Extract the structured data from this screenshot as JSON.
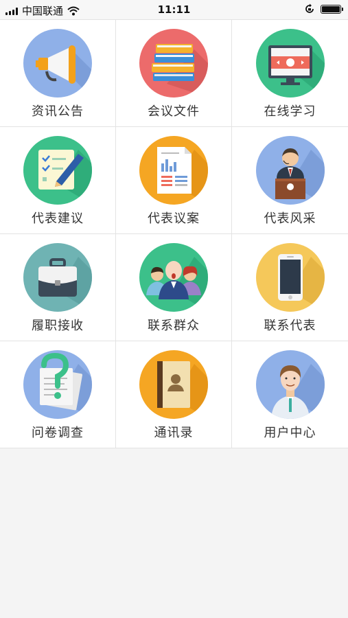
{
  "status_bar": {
    "carrier": "中国联通",
    "time": "11:11"
  },
  "menu": [
    {
      "label": "资讯公告",
      "icon": "megaphone-icon",
      "color": "#8fb0e8"
    },
    {
      "label": "会议文件",
      "icon": "books-icon",
      "color": "#ec6b6b"
    },
    {
      "label": "在线学习",
      "icon": "monitor-icon",
      "color": "#3cc08a"
    },
    {
      "label": "代表建议",
      "icon": "checklist-pencil-icon",
      "color": "#3cc08a"
    },
    {
      "label": "代表议案",
      "icon": "report-document-icon",
      "color": "#f5a623"
    },
    {
      "label": "代表风采",
      "icon": "speaker-podium-icon",
      "color": "#8fb0e8"
    },
    {
      "label": "履职接收",
      "icon": "briefcase-icon",
      "color": "#6fb3b3"
    },
    {
      "label": "联系群众",
      "icon": "people-group-icon",
      "color": "#3cc08a"
    },
    {
      "label": "联系代表",
      "icon": "smartphone-icon",
      "color": "#f5c85a"
    },
    {
      "label": "问卷调查",
      "icon": "questionnaire-icon",
      "color": "#8fb0e8"
    },
    {
      "label": "通讯录",
      "icon": "address-book-icon",
      "color": "#f5a623"
    },
    {
      "label": "用户中心",
      "icon": "user-avatar-icon",
      "color": "#8fb0e8"
    }
  ]
}
